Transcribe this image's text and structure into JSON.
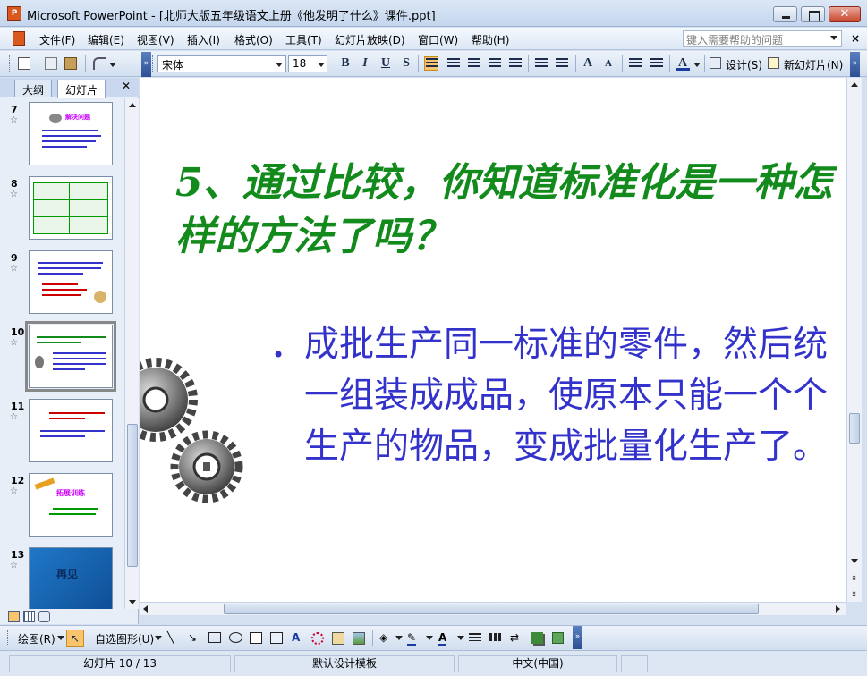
{
  "window": {
    "title": "Microsoft PowerPoint - [北师大版五年级语文上册《他发明了什么》课件.ppt]",
    "app_icon": "P"
  },
  "menu": {
    "items": [
      "文件(F)",
      "编辑(E)",
      "视图(V)",
      "插入(I)",
      "格式(O)",
      "工具(T)",
      "幻灯片放映(D)",
      "窗口(W)",
      "帮助(H)"
    ],
    "help_placeholder": "键入需要帮助的问题"
  },
  "toolbar": {
    "font_name": "宋体",
    "font_size": "18",
    "bold": "B",
    "italic": "I",
    "underline": "U",
    "shadow": "S",
    "design_label": "设计(S)",
    "new_slide_label": "新幻灯片(N)"
  },
  "left_panel": {
    "tabs": [
      "大纲",
      "幻灯片"
    ],
    "selected_tab": "幻灯片",
    "thumbnails": [
      {
        "number": "7",
        "label": "解决问题"
      },
      {
        "number": "8",
        "label": ""
      },
      {
        "number": "9",
        "label": ""
      },
      {
        "number": "10",
        "label": "",
        "current": true
      },
      {
        "number": "11",
        "label": ""
      },
      {
        "number": "12",
        "label": "拓展训练"
      },
      {
        "number": "13",
        "label": "再见"
      }
    ]
  },
  "slide": {
    "title": "5、通过比较，你知道标准化是一种怎样的方法了吗？",
    "bullet": "•",
    "body": "成批生产同一标准的零件，然后统一组装成成品，使原本只能一个个生产的物品，变成批量化生产了。"
  },
  "drawing_toolbar": {
    "draw_label": "绘图(R)",
    "autoshape_label": "自选图形(U)"
  },
  "status": {
    "slide_position": "幻灯片 10 / 13",
    "template": "默认设计模板",
    "language": "中文(中国)"
  },
  "colors": {
    "title_green": "#138a1c",
    "body_blue": "#3333cc"
  }
}
